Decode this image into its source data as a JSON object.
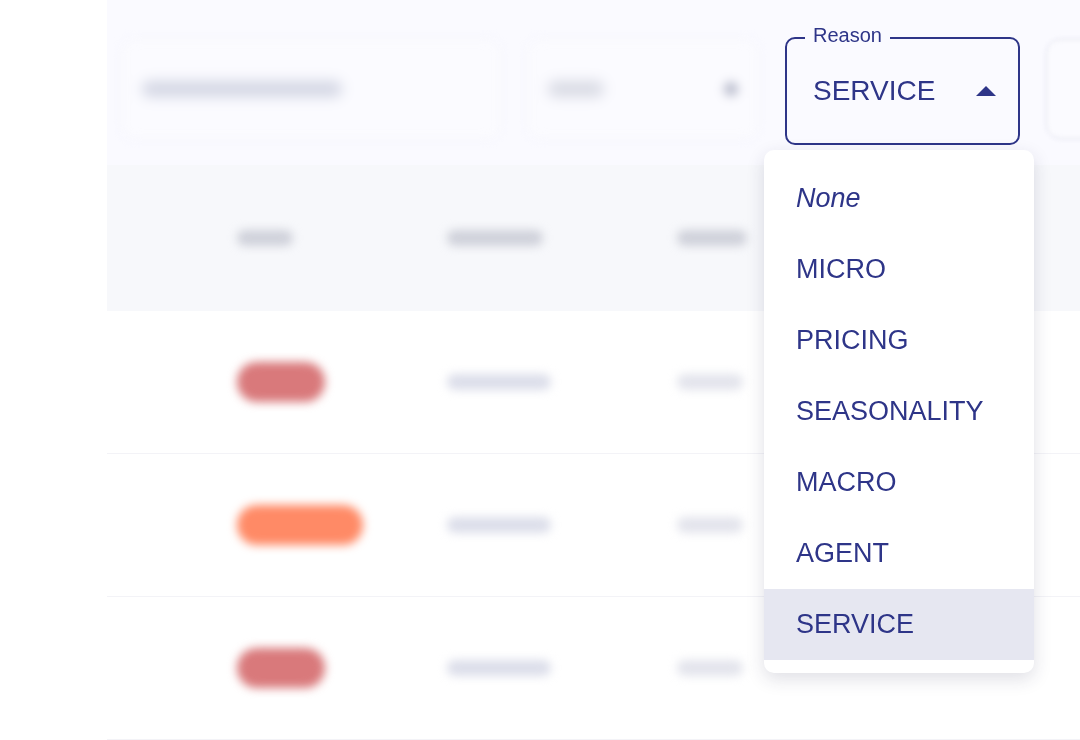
{
  "reason_select": {
    "label": "Reason",
    "value": "SERVICE",
    "expanded": true
  },
  "reason_menu": [
    {
      "label": "None",
      "kind": "none",
      "selected": false
    },
    {
      "label": "MICRO",
      "kind": "option",
      "selected": false
    },
    {
      "label": "PRICING",
      "kind": "option",
      "selected": false
    },
    {
      "label": "SEASONALITY",
      "kind": "option",
      "selected": false
    },
    {
      "label": "MACRO",
      "kind": "option",
      "selected": false
    },
    {
      "label": "AGENT",
      "kind": "option",
      "selected": false
    },
    {
      "label": "SERVICE",
      "kind": "option",
      "selected": true
    }
  ],
  "blurred_rows": [
    {
      "color": "#d9797b"
    },
    {
      "color": "#ff8a66"
    },
    {
      "color": "#d9797b"
    }
  ]
}
